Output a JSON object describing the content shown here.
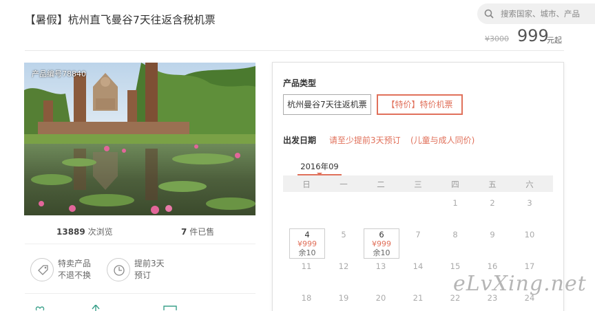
{
  "header": {
    "title": "【暑假】杭州直飞曼谷7天往返含税机票",
    "search_placeholder": "搜索国家、城市、产品",
    "old_price": "¥3000",
    "price": "999",
    "price_unit": "元起"
  },
  "product": {
    "code": "产品编号78840",
    "views_count": "13889",
    "views_label": "次浏览",
    "sold_count": "7",
    "sold_label": "件已售",
    "features": [
      {
        "icon": "tag-icon",
        "line1": "特卖产品",
        "line2": "不退不换"
      },
      {
        "icon": "clock-icon",
        "line1": "提前3天",
        "line2": "预订"
      }
    ]
  },
  "booking": {
    "type_label": "产品类型",
    "options": [
      "杭州曼谷7天往返机票",
      "【特价】特价机票"
    ],
    "date_label": "出发日期",
    "note1": "请至少提前3天预订",
    "note2": "(儿童与成人同价)",
    "month": "2016年09",
    "weekdays": [
      "日",
      "一",
      "二",
      "三",
      "四",
      "五",
      "六"
    ],
    "days": [
      "1",
      "2",
      "3",
      "4",
      "5",
      "6",
      "7",
      "8",
      "9",
      "10",
      "11",
      "12",
      "13",
      "14",
      "15",
      "16",
      "17",
      "18",
      "19",
      "20",
      "21",
      "22",
      "23",
      "24"
    ],
    "available": [
      {
        "day": "4",
        "price": "¥999",
        "stock": "余10"
      },
      {
        "day": "6",
        "price": "¥999",
        "stock": "余10"
      }
    ]
  },
  "watermark": "eLvXing.net"
}
